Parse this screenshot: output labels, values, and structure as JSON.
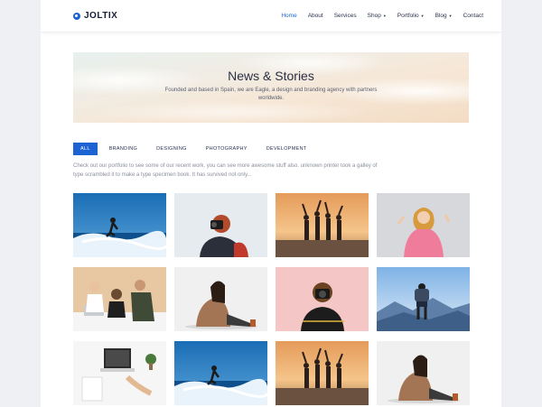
{
  "brand": {
    "name": "JOLTIX",
    "logo_icon": "circle-logo-icon",
    "color": "#1e63d3"
  },
  "nav": {
    "items": [
      {
        "label": "Home",
        "active": true
      },
      {
        "label": "About",
        "dropdown": false
      },
      {
        "label": "Services",
        "dropdown": false
      },
      {
        "label": "Shop",
        "dropdown": true
      },
      {
        "label": "Portfolio",
        "dropdown": true
      },
      {
        "label": "Blog",
        "dropdown": true
      },
      {
        "label": "Contact",
        "dropdown": false
      }
    ],
    "caret_icon": "caret-down-icon"
  },
  "hero": {
    "title": "News & Stories",
    "subtitle": "Founded and based in Spain, we are Eagle, a design and branding agency with partners worldwide."
  },
  "filters": [
    "ALL",
    "BRANDING",
    "DESIGNING",
    "PHOTOGRAPHY",
    "DEVELOPMENT"
  ],
  "active_filter": "ALL",
  "intro": "Check out our portfolio to see some of our recent work, you can see more awesome stuff also. unknown printer took a galley of type scrambled it to make a type specimen book. It has survived not only...",
  "portfolio": [
    {
      "name": "surfer-wave",
      "scene": "surf"
    },
    {
      "name": "photographer-backpack",
      "scene": "photo-back"
    },
    {
      "name": "friends-sunset-beach",
      "scene": "sunset"
    },
    {
      "name": "woman-pink-hoodie",
      "scene": "hoodie"
    },
    {
      "name": "team-meeting-laptop",
      "scene": "team"
    },
    {
      "name": "woman-sitting-camera",
      "scene": "sitting"
    },
    {
      "name": "photographer-pink",
      "scene": "photo-pink"
    },
    {
      "name": "hiker-mountains",
      "scene": "mountain"
    },
    {
      "name": "desk-laptop-top-view",
      "scene": "desk"
    },
    {
      "name": "surfer-wave-2",
      "scene": "surf"
    },
    {
      "name": "friends-sunset-beach-2",
      "scene": "sunset"
    },
    {
      "name": "woman-sitting-camera-2",
      "scene": "sitting"
    }
  ],
  "colors": {
    "accent": "#1e63d3",
    "text": "#2a3350",
    "muted": "#8a8f9c"
  }
}
